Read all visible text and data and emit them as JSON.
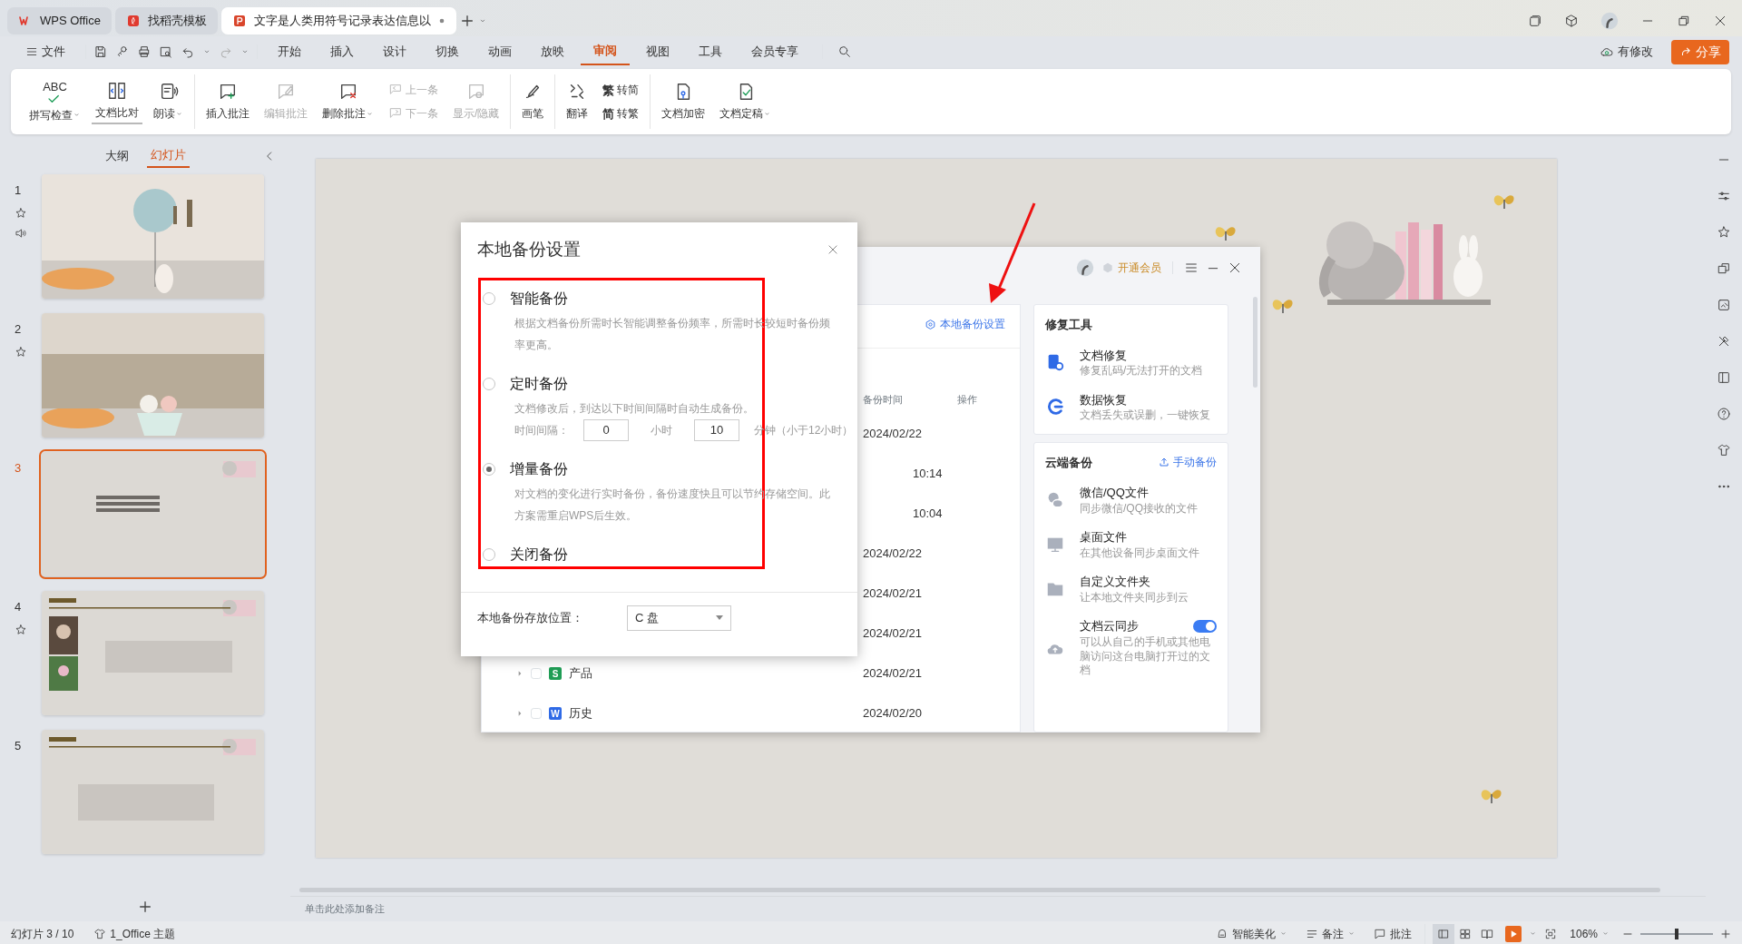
{
  "tabs": [
    {
      "label": "WPS Office",
      "selected": false,
      "kind": "wps"
    },
    {
      "label": "找稻壳模板",
      "selected": false,
      "kind": "docer"
    },
    {
      "label": "文字是人类用符号记录表达信息以",
      "selected": true,
      "kind": "ppt",
      "unsaved": true
    }
  ],
  "menu": {
    "file": "文件",
    "tabs": [
      {
        "label": "开始",
        "selected": false
      },
      {
        "label": "插入",
        "selected": false
      },
      {
        "label": "设计",
        "selected": false
      },
      {
        "label": "切换",
        "selected": false
      },
      {
        "label": "动画",
        "selected": false
      },
      {
        "label": "放映",
        "selected": false
      },
      {
        "label": "审阅",
        "selected": true
      },
      {
        "label": "视图",
        "selected": false
      },
      {
        "label": "工具",
        "selected": false
      },
      {
        "label": "会员专享",
        "selected": false
      }
    ],
    "sync_status": "有修改",
    "share": "分享"
  },
  "ribbon": [
    [
      {
        "kind": "large",
        "glyph": "ABC",
        "label": "拼写检查",
        "dropdown": true,
        "disabled": false,
        "selected": false
      },
      {
        "kind": "large",
        "label": "文档比对",
        "dropdown": false,
        "disabled": false,
        "selected": true
      },
      {
        "kind": "large",
        "label": "朗读",
        "dropdown": true,
        "disabled": false,
        "selected": false
      }
    ],
    [
      {
        "kind": "large",
        "label": "插入批注",
        "dropdown": false,
        "disabled": false,
        "selected": false
      },
      {
        "kind": "large",
        "label": "编辑批注",
        "dropdown": false,
        "disabled": true,
        "selected": false
      },
      {
        "kind": "large",
        "label": "删除批注",
        "dropdown": true,
        "disabled": false,
        "selected": false
      },
      {
        "kind": "pair",
        "items": [
          {
            "label": "上一条",
            "disabled": true
          },
          {
            "label": "下一条",
            "disabled": true
          }
        ]
      },
      {
        "kind": "large",
        "label": "显示/隐藏",
        "dropdown": false,
        "disabled": true,
        "selected": false
      }
    ],
    [
      {
        "kind": "large",
        "label": "画笔",
        "dropdown": false,
        "disabled": false,
        "selected": false
      }
    ],
    [
      {
        "kind": "large",
        "label": "翻译",
        "dropdown": false,
        "disabled": false,
        "selected": false
      },
      {
        "kind": "pair",
        "items": [
          {
            "glyph": "繁",
            "label": "转简",
            "disabled": false
          },
          {
            "glyph": "简",
            "label": "转繁",
            "disabled": false
          }
        ]
      }
    ],
    [
      {
        "kind": "large",
        "label": "文档加密",
        "dropdown": false,
        "disabled": false,
        "selected": false
      },
      {
        "kind": "large",
        "label": "文档定稿",
        "dropdown": true,
        "disabled": false,
        "selected": false
      }
    ]
  ],
  "slides_panel": {
    "views": [
      {
        "label": "大纲",
        "selected": false
      },
      {
        "label": "幻灯片",
        "selected": true
      }
    ],
    "slides": [
      {
        "number": "1",
        "selected": false,
        "animated": true,
        "audio": true
      },
      {
        "number": "2",
        "selected": false,
        "animated": true,
        "audio": false
      },
      {
        "number": "3",
        "selected": true,
        "animated": false,
        "audio": false
      },
      {
        "number": "4",
        "selected": false,
        "animated": true,
        "audio": false
      },
      {
        "number": "5",
        "selected": false,
        "animated": false,
        "audio": false
      }
    ]
  },
  "notes_placeholder": "单击此处添加备注",
  "backup_window": {
    "member": "开通会员",
    "settings_link": "本地备份设置",
    "columns": [
      "备份时间",
      "操作"
    ],
    "rows": [
      {
        "kind": "day",
        "time": "2024/02/22"
      },
      {
        "kind": "version",
        "time": "10:14"
      },
      {
        "kind": "version",
        "time": "10:04"
      },
      {
        "kind": "day",
        "time": "2024/02/22"
      },
      {
        "kind": "day",
        "time": "2024/02/21"
      },
      {
        "kind": "day",
        "time": "2024/02/21"
      },
      {
        "kind": "file",
        "badge": "S",
        "color": "#1f9d55",
        "name": "产品",
        "time": "2024/02/21",
        "checked": false,
        "expanded": false
      },
      {
        "kind": "file",
        "badge": "W",
        "color": "#2f6ae6",
        "name": "历史",
        "time": "2024/02/20",
        "checked": false,
        "expanded": false
      }
    ],
    "repair": {
      "title": "修复工具",
      "items": [
        {
          "title": "文档修复",
          "desc": "修复乱码/无法打开的文档"
        },
        {
          "title": "数据恢复",
          "desc": "文档丢失或误删，一键恢复"
        }
      ]
    },
    "cloud": {
      "title": "云端备份",
      "action": "手动备份",
      "items": [
        {
          "title": "微信/QQ文件",
          "desc": "同步微信/QQ接收的文件",
          "kind": "plain"
        },
        {
          "title": "桌面文件",
          "desc": "在其他设备同步桌面文件",
          "kind": "plain"
        },
        {
          "title": "自定义文件夹",
          "desc": "让本地文件夹同步到云",
          "kind": "plain"
        },
        {
          "title": "文档云同步",
          "desc": "可以从自己的手机或其他电脑访问这台电脑打开过的文档",
          "kind": "toggle",
          "on": true
        }
      ]
    }
  },
  "dialog": {
    "title": "本地备份设置",
    "options": [
      {
        "kind": "text",
        "label": "智能备份",
        "selected": false,
        "description": "根据文档备份所需时长智能调整备份频率，所需时长较短时备份频率更高。"
      },
      {
        "kind": "interval",
        "label": "定时备份",
        "selected": false,
        "description": "文档修改后，到达以下时间间隔时自动生成备份。",
        "interval_label": "时间间隔：",
        "hours": "0",
        "hours_unit": "小时",
        "minutes": "10",
        "minutes_unit": "分钟（小于12小时）"
      },
      {
        "kind": "text",
        "label": "增量备份",
        "selected": true,
        "description": "对文档的变化进行实时备份，备份速度快且可以节约存储空间。此方案需重启WPS后生效。"
      },
      {
        "kind": "none",
        "label": "关闭备份",
        "selected": false
      }
    ],
    "location_label": "本地备份存放位置：",
    "location": "C 盘"
  },
  "status": {
    "slide": "幻灯片 3 / 10",
    "theme": "1_Office 主题",
    "beautify": "智能美化",
    "notes": "备注",
    "comments": "批注",
    "views": [
      {
        "selected": true
      },
      {
        "selected": false
      },
      {
        "selected": false
      }
    ],
    "zoom": {
      "reading": "106%",
      "level": 0.5
    }
  }
}
